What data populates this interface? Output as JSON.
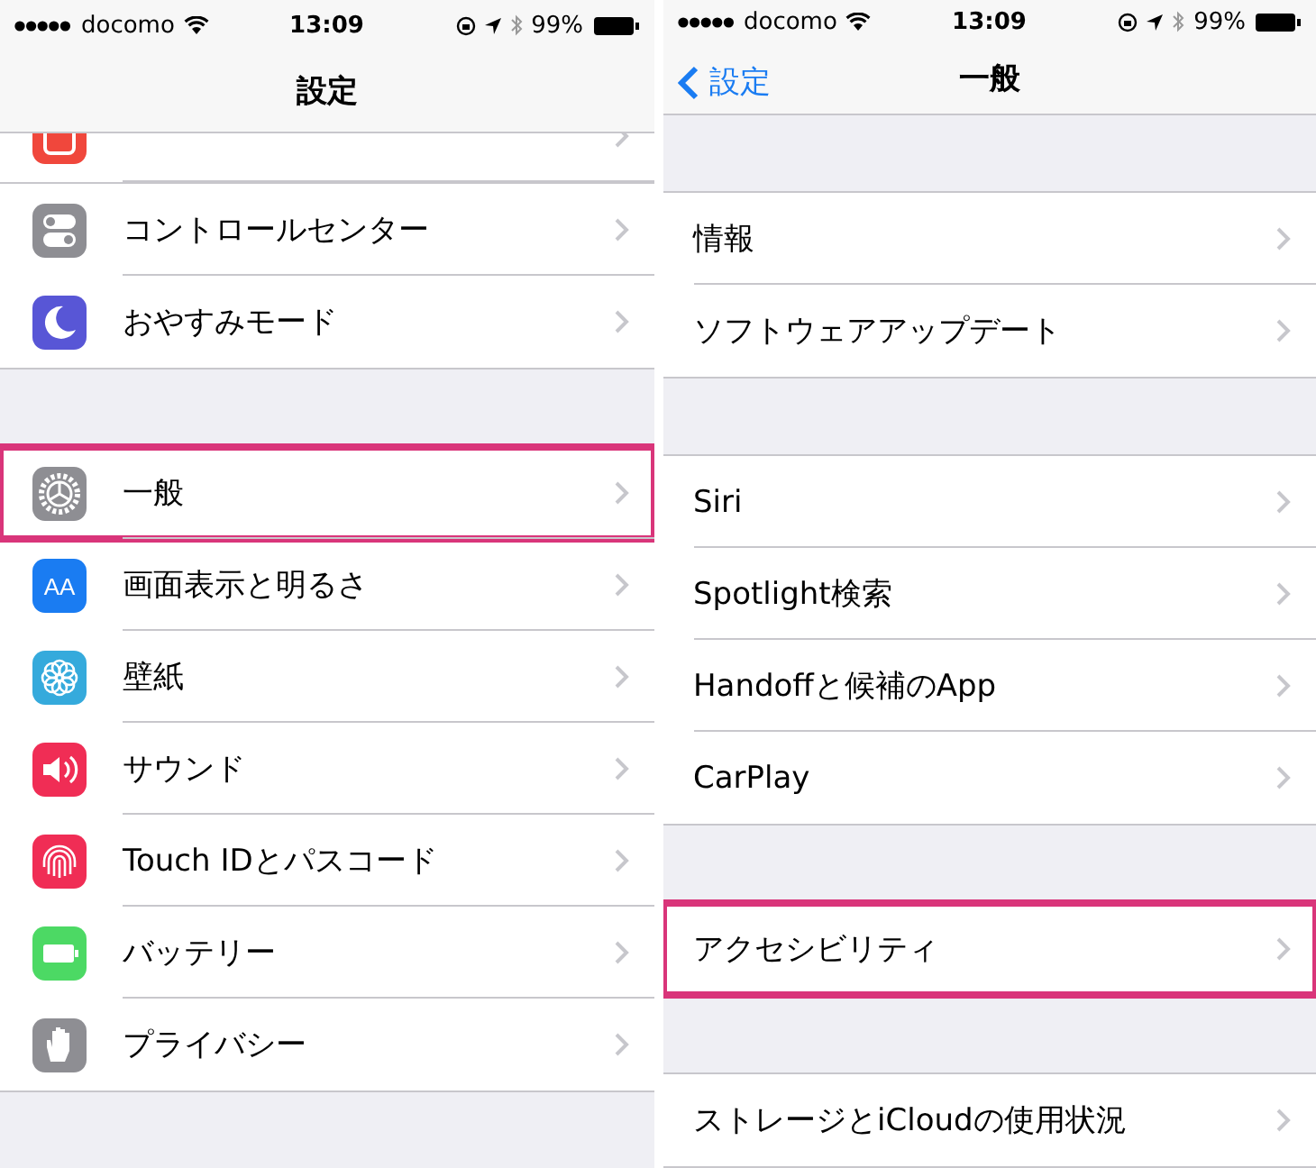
{
  "panels": [
    {
      "status": {
        "carrier": "docomo",
        "time": "13:09",
        "battery": "99%"
      },
      "nav": {
        "title": "設定"
      },
      "partial_row": {
        "kind": "bell",
        "color": "#f0473c"
      },
      "groups": [
        [
          {
            "label": "コントロールセンター",
            "kind": "toggles",
            "color": "#8e8e93",
            "highlighted": false
          },
          {
            "label": "おやすみモード",
            "kind": "moon",
            "color": "#5856d6",
            "highlighted": false
          }
        ],
        [
          {
            "label": "一般",
            "kind": "gear",
            "color": "#8e8e93",
            "highlighted": true
          },
          {
            "label": "画面表示と明るさ",
            "kind": "text",
            "icon_text": "AA",
            "color": "#1a7cf2",
            "highlighted": false
          },
          {
            "label": "壁紙",
            "kind": "flower",
            "color": "#35aadc",
            "highlighted": false
          },
          {
            "label": "サウンド",
            "kind": "speaker",
            "color": "#f02d55",
            "highlighted": false
          },
          {
            "label": "Touch IDとパスコード",
            "kind": "fingerprint",
            "color": "#f02d55",
            "highlighted": false
          },
          {
            "label": "バッテリー",
            "kind": "battery",
            "color": "#4cd964",
            "highlighted": false
          },
          {
            "label": "プライバシー",
            "kind": "hand",
            "color": "#8e8e93",
            "highlighted": false
          }
        ]
      ]
    },
    {
      "status": {
        "carrier": "docomo",
        "time": "13:09",
        "battery": "99%"
      },
      "nav": {
        "back": "設定",
        "title": "一般"
      },
      "groups": [
        [
          {
            "label": "情報",
            "highlighted": false
          },
          {
            "label": "ソフトウェアアップデート",
            "highlighted": false
          }
        ],
        [
          {
            "label": "Siri",
            "highlighted": false
          },
          {
            "label": "Spotlight検索",
            "highlighted": false
          },
          {
            "label": "Handoffと候補のApp",
            "highlighted": false
          },
          {
            "label": "CarPlay",
            "highlighted": false
          }
        ],
        [
          {
            "label": "アクセシビリティ",
            "highlighted": true
          }
        ],
        [
          {
            "label": "ストレージとiCloudの使用状況",
            "highlighted": false
          }
        ]
      ]
    }
  ]
}
